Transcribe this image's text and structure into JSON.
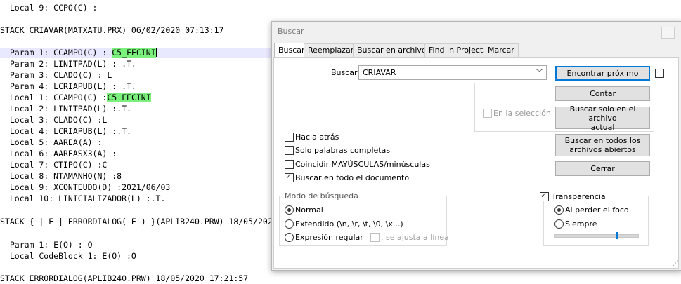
{
  "editor": {
    "lines": [
      "  Local 9: CCPO(C) :",
      "",
      "STACK CRIAVAR(MATXATU.PRX) 06/02/2020 07:13:17",
      "",
      "  Param 1: CCAMPO(C) : ",
      "  Param 2: LINITPAD(L) : .T.",
      "  Param 3: CLADO(C) : L",
      "  Param 4: LCRIAPUB(L) : .T.",
      "  Local 1: CCAMPO(C) :",
      "  Local 2: LINITPAD(L) :.T.",
      "  Local 3: CLADO(C) :L",
      "  Local 4: LCRIAPUB(L) :.T.",
      "  Local 5: AAREA(A) :",
      "  Local 6: AAREASX3(A) :",
      "  Local 7: CTIPO(C) :C",
      "  Local 8: NTAMANHO(N) :8",
      "  Local 9: XCONTEUDO(D) :2021/06/03",
      "  Local 10: LINICIALIZADOR(L) :.T.",
      "",
      "STACK { | E | ERRORDIALOG( E ) }(APLIB240.PRW) 18/05/2020 17:21:57",
      "",
      "  Param 1: E(O) : O",
      "  Local CodeBlock 1: E(O) :O",
      "",
      "STACK ERRORDIALOG(APLIB240.PRW) 18/05/2020 17:21:57"
    ],
    "highlight_text": "C5_FECINI"
  },
  "dialog": {
    "title": "Buscar",
    "tabs": [
      "Buscar",
      "Reemplazar",
      "Buscar en archivos",
      "Find in Projects",
      "Marcar"
    ],
    "search_label": "Buscar:",
    "search_value": "CRIAVAR",
    "buttons": {
      "find_next": "Encontrar próximo",
      "count": "Contar",
      "search_current_line1": "Buscar solo en el archivo",
      "search_current_line2": "actual",
      "search_all_line1": "Buscar en todos los",
      "search_all_line2": "archivos abiertos",
      "close": "Cerrar"
    },
    "in_selection": "En la selección",
    "options": {
      "backward": "Hacia atrás",
      "whole_words": "Solo palabras completas",
      "match_case": "Coincidir MAYÚSCULAS/minúsculas",
      "wrap": "Buscar en todo el documento"
    },
    "search_mode": {
      "title": "Modo de búsqueda",
      "normal": "Normal",
      "extended": "Extendido (\\n, \\r, \\t, \\0, \\x...)",
      "regex": "Expresión regular",
      "dot_newline": ". se ajusta a línea"
    },
    "transparency": {
      "title": "Transparencia",
      "on_lose_focus": "Al perder el foco",
      "always": "Siempre",
      "slider_level": 0.75
    },
    "accent_color": "#0078d7"
  }
}
